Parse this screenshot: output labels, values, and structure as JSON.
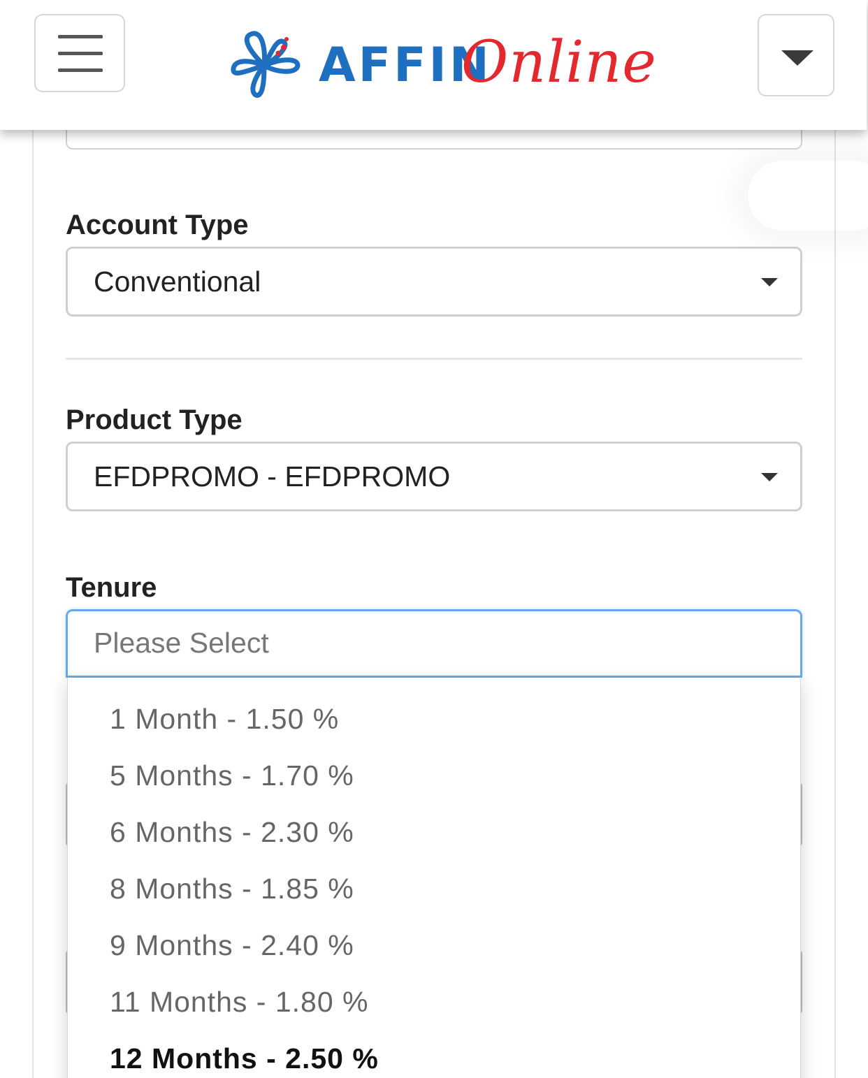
{
  "header": {
    "logo_affin": "AFFIN",
    "logo_online": "Online"
  },
  "colors": {
    "brand_blue": "#1f6fc0",
    "brand_red": "#e3282e",
    "focus_border": "#6aa9e6"
  },
  "icons": {
    "menu": "hamburger-icon",
    "dropdown": "caret-down-icon",
    "logo": "affin-flower-logo"
  },
  "form": {
    "account_type": {
      "label": "Account Type",
      "value": "Conventional"
    },
    "product_type": {
      "label": "Product Type",
      "value": "EFDPROMO - EFDPROMO"
    },
    "tenure": {
      "label": "Tenure",
      "placeholder": "Please Select",
      "options": [
        "1 Month - 1.50 %",
        "5 Months - 1.70 %",
        "6 Months - 2.30 %",
        "8 Months - 1.85 %",
        "9 Months - 2.40 %",
        "11 Months - 1.80 %",
        "12 Months - 2.50 %"
      ],
      "highlighted_index": 6
    }
  }
}
